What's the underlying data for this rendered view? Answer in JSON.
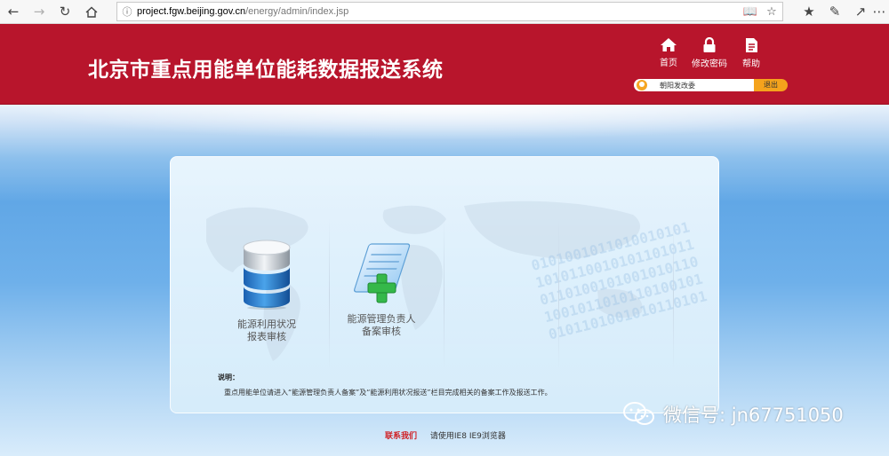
{
  "browser": {
    "url_host": "project.fgw.beijing.gov.cn",
    "url_path": "/energy/admin/index.jsp",
    "icons": [
      "back-icon",
      "forward-icon",
      "refresh-icon",
      "home-icon",
      "info-icon",
      "reading-view-icon",
      "favorite-star-icon",
      "favorites-icon",
      "pen-icon",
      "share-icon",
      "more-icon"
    ]
  },
  "header": {
    "title": "北京市重点用能单位能耗数据报送系统",
    "links": [
      {
        "label": "首页",
        "icon": "home-icon"
      },
      {
        "label": "修改密码",
        "icon": "lock-icon"
      },
      {
        "label": "帮助",
        "icon": "document-icon"
      }
    ],
    "user_name": "朝阳发改委",
    "logout_label": "退出",
    "colors": {
      "brand_red": "#b8152c",
      "logout_orange": "#f5a31c"
    }
  },
  "modules": [
    {
      "label_line1": "能源利用状况",
      "label_line2": "报表审核",
      "icon": "database-icon"
    },
    {
      "label_line1": "能源管理负责人",
      "label_line2": "备案审核",
      "icon": "document-add-icon"
    }
  ],
  "note": {
    "title": "说明：",
    "text": "重点用能单位请进入“能源管理负责人备案”及“能源利用状况报送”栏目完成相关的备案工作及报送工作。"
  },
  "footer": {
    "contact_label": "联系我们",
    "browser_tip": "请使用IE8 IE9浏览器"
  },
  "watermark": {
    "text": "微信号: jn67751050"
  }
}
